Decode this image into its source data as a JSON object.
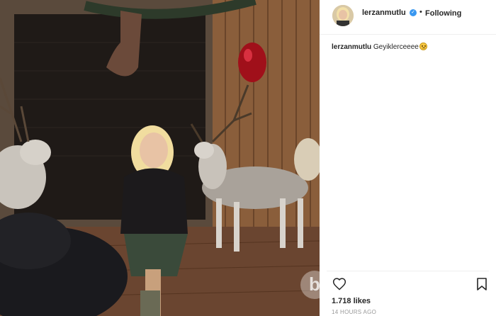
{
  "post": {
    "username": "lerzanmutlu",
    "follow_status": "Following",
    "separator": "•",
    "caption_user": "lerzanmutlu",
    "caption_text": "Geyiklerceeee",
    "likes": "1.718 likes",
    "timestamp": "14 HOURS AGO",
    "watermark_letter": "b"
  },
  "icons": {
    "verified": "verified-badge-icon",
    "like": "heart-icon",
    "save": "bookmark-icon",
    "emoji": "smile-emoji-icon"
  },
  "colors": {
    "verified_blue": "#3897f0",
    "text": "#262626",
    "muted": "#999999",
    "border": "#efefef"
  }
}
